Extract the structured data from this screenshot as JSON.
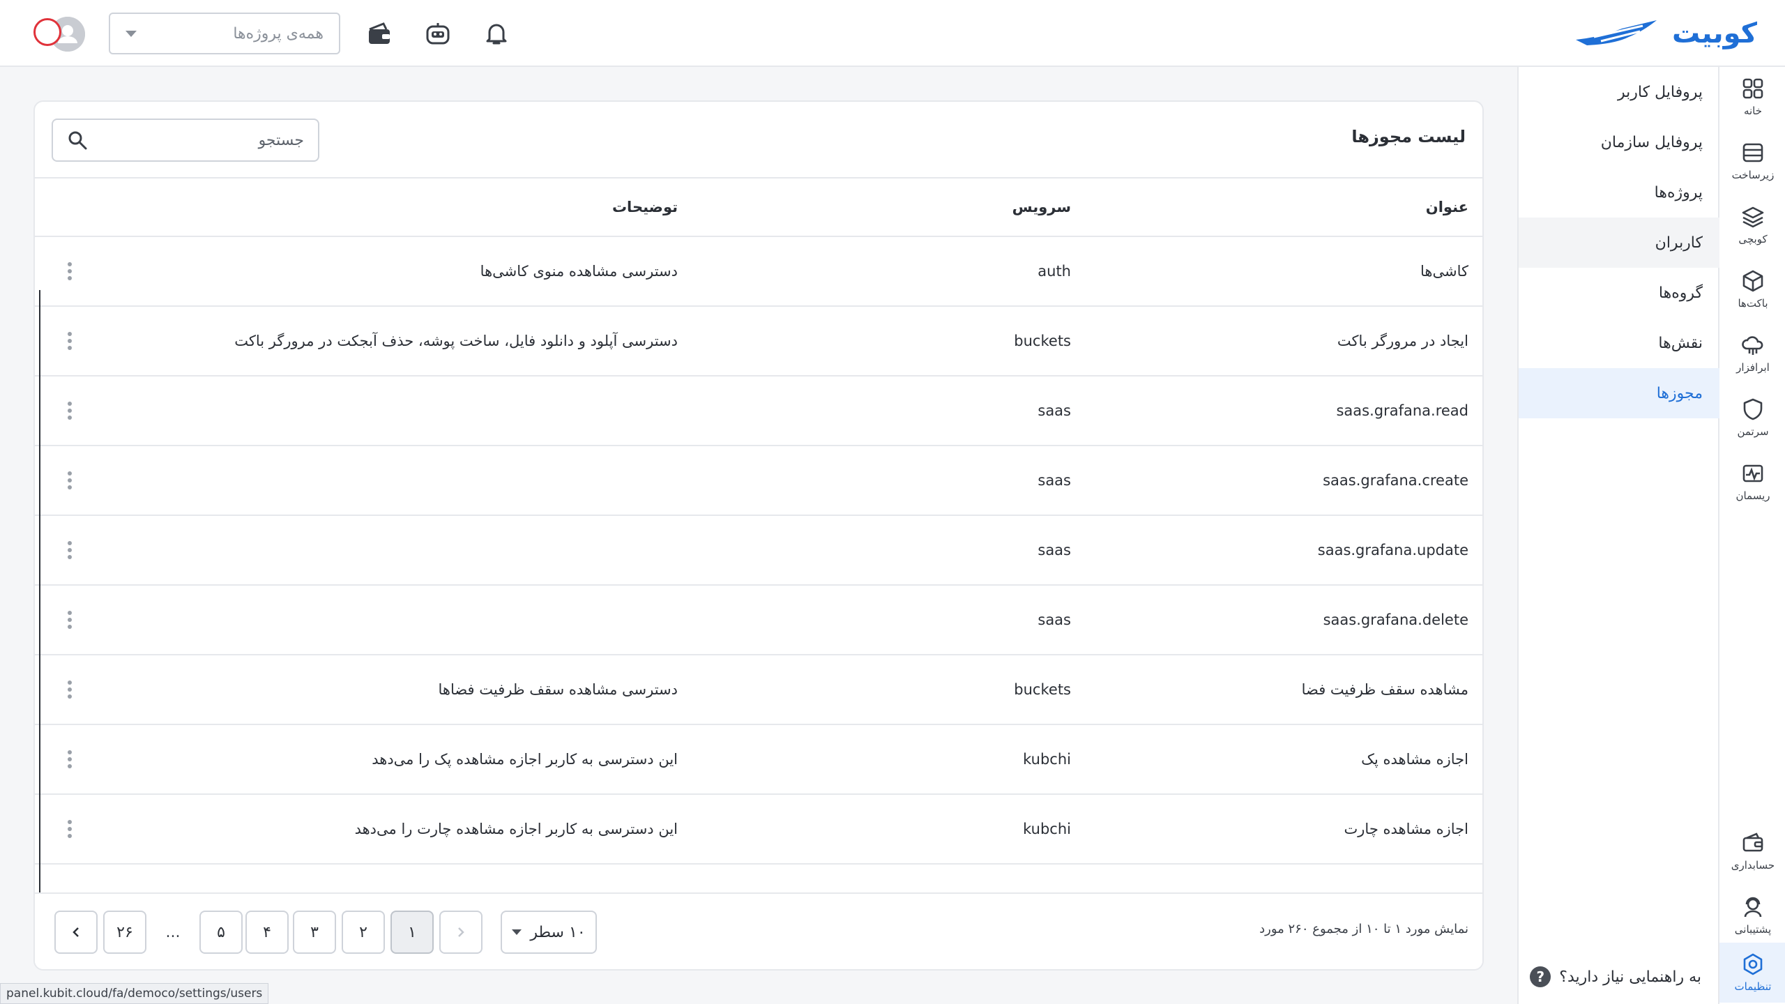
{
  "header": {
    "logo_text": "کوبیت",
    "project_select_placeholder": "همه‌ی پروژه‌ها",
    "brand_color": "#1f6fd6"
  },
  "rail": {
    "items": [
      {
        "label": "خانه",
        "icon": "grid-icon"
      },
      {
        "label": "زیرساخت",
        "icon": "server-icon"
      },
      {
        "label": "کوبچی",
        "icon": "layers-icon"
      },
      {
        "label": "باکت‌ها",
        "icon": "box-icon"
      },
      {
        "label": "ابرافزار",
        "icon": "cloud-icon"
      },
      {
        "label": "سرتمن",
        "icon": "shield-icon"
      },
      {
        "label": "ریسمان",
        "icon": "pulse-icon"
      },
      {
        "label": "حسابداری",
        "icon": "wallet-icon"
      },
      {
        "label": "پشتیبانی",
        "icon": "support-icon"
      },
      {
        "label": "تنظیمات",
        "icon": "settings-icon"
      }
    ]
  },
  "subnav": {
    "items": [
      {
        "label": "پروفایل کاربر"
      },
      {
        "label": "پروفایل سازمان"
      },
      {
        "label": "پروژه‌ها"
      },
      {
        "label": "کاربران"
      },
      {
        "label": "گروه‌ها"
      },
      {
        "label": "نقش‌ها"
      },
      {
        "label": "مجوزها"
      }
    ],
    "help_label": "به راهنمایی نیاز دارید؟",
    "help_icon": "?"
  },
  "card": {
    "title": "لیست مجوزها",
    "search_placeholder": "جستجو"
  },
  "table": {
    "headers": {
      "title": "عنوان",
      "service": "سرویس",
      "description": "توضیحات"
    },
    "rows": [
      {
        "title": "کاشی‌ها",
        "service": "auth",
        "description": "دسترسی مشاهده منوی کاشی‌ها"
      },
      {
        "title": "ایجاد در مرورگر باکت",
        "service": "buckets",
        "description": "دسترسی آپلود و دانلود فایل، ساخت پوشه، حذف آبجکت در مرورگر باکت"
      },
      {
        "title": "saas.grafana.read",
        "service": "saas",
        "description": ""
      },
      {
        "title": "saas.grafana.create",
        "service": "saas",
        "description": ""
      },
      {
        "title": "saas.grafana.update",
        "service": "saas",
        "description": ""
      },
      {
        "title": "saas.grafana.delete",
        "service": "saas",
        "description": ""
      },
      {
        "title": "مشاهده سقف ظرفیت فضا",
        "service": "buckets",
        "description": "دسترسی مشاهده سقف ظرفیت فضاها"
      },
      {
        "title": "اجازه مشاهده پک",
        "service": "kubchi",
        "description": "این دسترسی به کاربر اجازه مشاهده پک را می‌دهد"
      },
      {
        "title": "اجازه مشاهده چارت",
        "service": "kubchi",
        "description": "این دسترسی به کاربر اجازه مشاهده چارت را می‌دهد"
      }
    ]
  },
  "footer": {
    "summary": "نمایش مورد ۱ تا ۱۰ از مجموع ۲۶۰ مورد",
    "rows_per_page": "۱۰ سطر",
    "pages": [
      "۱",
      "۲",
      "۳",
      "۴",
      "۵"
    ],
    "ellipsis": "...",
    "last_page": "۲۶",
    "current_page": "۱"
  },
  "status_bar": {
    "url": "panel.kubit.cloud/fa/democo/settings/users"
  }
}
